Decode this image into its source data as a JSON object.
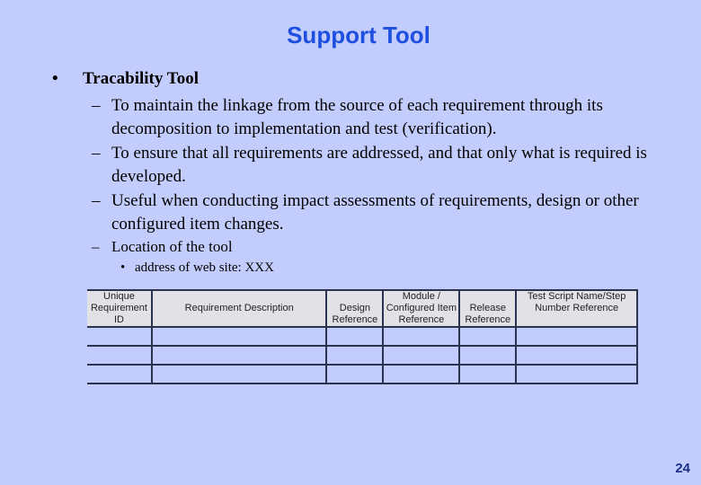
{
  "slide": {
    "title": "Support Tool",
    "page_number": "24"
  },
  "content": {
    "bullet_symbol": "•",
    "dash_symbol": "–",
    "main_point": "Tracability Tool",
    "sub_points": [
      "To maintain the linkage from the source of each requirement through its decomposition to implementation and test (verification).",
      "To ensure that all requirements are addressed, and that only what is required is developed.",
      "Useful when conducting impact assessments of requirements, design or other configured item changes.",
      "Location of the tool"
    ],
    "sub_sub_point": "address of web site: XXX"
  },
  "table": {
    "headers": [
      "Unique Requirement ID",
      "Requirement Description",
      "Design Reference",
      "Module / Configured Item Reference",
      "Release Reference",
      "Test Script Name/Step Number Reference"
    ],
    "rows": [
      [
        "",
        "",
        "",
        "",
        "",
        ""
      ],
      [
        "",
        "",
        "",
        "",
        "",
        ""
      ],
      [
        "",
        "",
        "",
        "",
        "",
        ""
      ]
    ]
  }
}
